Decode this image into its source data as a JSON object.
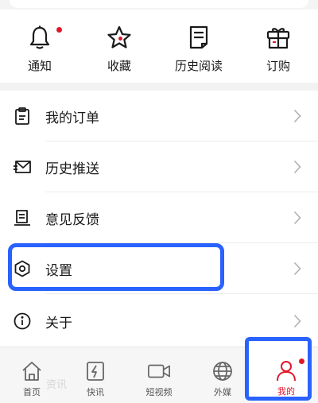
{
  "quick_actions": [
    {
      "label": "通知",
      "icon": "bell-icon",
      "badge": true
    },
    {
      "label": "收藏",
      "icon": "star-icon",
      "badge": false
    },
    {
      "label": "历史阅读",
      "icon": "document-icon",
      "badge": false
    },
    {
      "label": "订购",
      "icon": "gift-box-icon",
      "badge": false
    }
  ],
  "menu": [
    {
      "label": "我的订单",
      "icon": "clipboard-icon"
    },
    {
      "label": "历史推送",
      "icon": "envelope-icon"
    },
    {
      "label": "意见反馈",
      "icon": "feedback-icon"
    },
    {
      "label": "设置",
      "icon": "hexagon-settings-icon"
    },
    {
      "label": "关于",
      "icon": "info-icon"
    }
  ],
  "tabbar": [
    {
      "label": "首页",
      "icon": "home-icon",
      "active": false
    },
    {
      "label": "快讯",
      "icon": "flash-news-icon",
      "active": false
    },
    {
      "label": "短视频",
      "icon": "video-icon",
      "active": false
    },
    {
      "label": "外媒",
      "icon": "globe-icon",
      "active": false
    },
    {
      "label": "我的",
      "icon": "user-icon",
      "active": true
    }
  ],
  "colors": {
    "accent_red": "#e0182a",
    "highlight_blue": "#2962ff"
  }
}
